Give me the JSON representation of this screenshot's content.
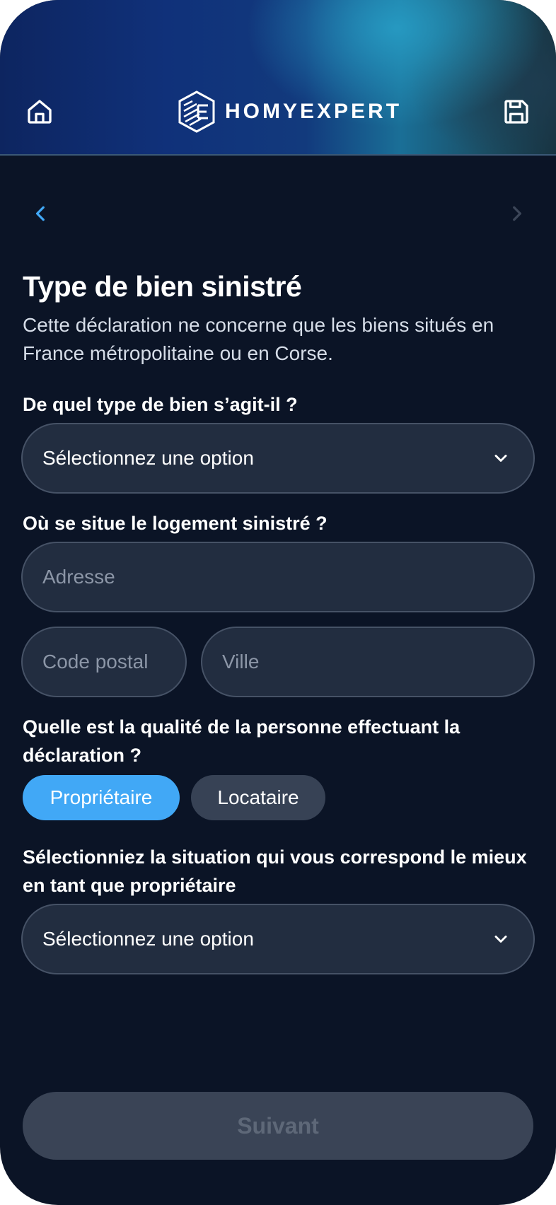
{
  "header": {
    "brand": "HOMYEXPERT",
    "home_icon": "home-icon",
    "save_icon": "save-icon"
  },
  "nav": {
    "prev_icon": "chevron-left-icon",
    "next_icon": "chevron-right-icon"
  },
  "page": {
    "title": "Type de bien sinistré",
    "subtitle": "Cette déclaration ne concerne que les biens situés en France métropolitaine ou en Corse."
  },
  "q_property_type": {
    "label": "De quel type de bien s’agit-il ?",
    "select_value": "Sélectionnez une option"
  },
  "q_location": {
    "label": "Où se situe le logement sinistré ?",
    "address_placeholder": "Adresse",
    "postal_placeholder": "Code postal",
    "city_placeholder": "Ville"
  },
  "q_role": {
    "label": "Quelle est la qualité de la personne effectuant la déclaration ?",
    "options": [
      "Propriétaire",
      "Locataire"
    ],
    "selected": "Propriétaire"
  },
  "q_situation": {
    "label": "Sélectionniez la situation qui vous correspond le mieux en tant que propriétaire",
    "select_value": "Sélectionnez une option"
  },
  "footer": {
    "next_label": "Suivant"
  },
  "colors": {
    "background": "#0b1426",
    "accent": "#41a8f6",
    "field": "#222d40",
    "disabled_button": "#3a4456"
  }
}
